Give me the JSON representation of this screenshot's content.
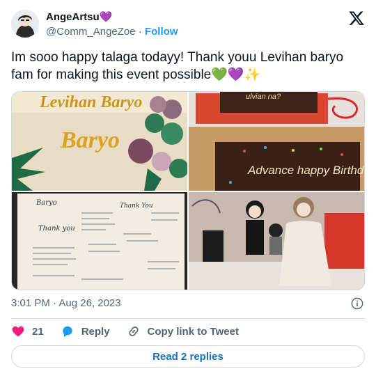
{
  "author": {
    "display_name": "AngeArtsu",
    "name_emoji": "💜",
    "handle": "@Comm_AngeZoe",
    "separator": "·",
    "follow_label": "Follow"
  },
  "tweet": {
    "text": "Im sooo happy talaga todayy! Thank youu Levihan baryo fam for making this event possible💚💜✨"
  },
  "photos": [
    {
      "alt_text": "Levihan Baryo"
    },
    {
      "alt_text": "Advance happy Birthday"
    },
    {
      "alt_text": "Thank you"
    },
    {
      "alt_text": ""
    }
  ],
  "meta": {
    "timestamp": "3:01 PM · Aug 26, 2023"
  },
  "actions": {
    "likes": "21",
    "reply_label": "Reply",
    "copy_label": "Copy link to Tweet"
  },
  "read_replies_label": "Read 2 replies",
  "colors": {
    "accent": "#1d9bf0",
    "like": "#f91880",
    "text": "#0f1419",
    "muted": "#536471"
  },
  "icons": [
    "x-logo-icon",
    "info-icon",
    "heart-icon",
    "reply-icon",
    "link-icon"
  ]
}
